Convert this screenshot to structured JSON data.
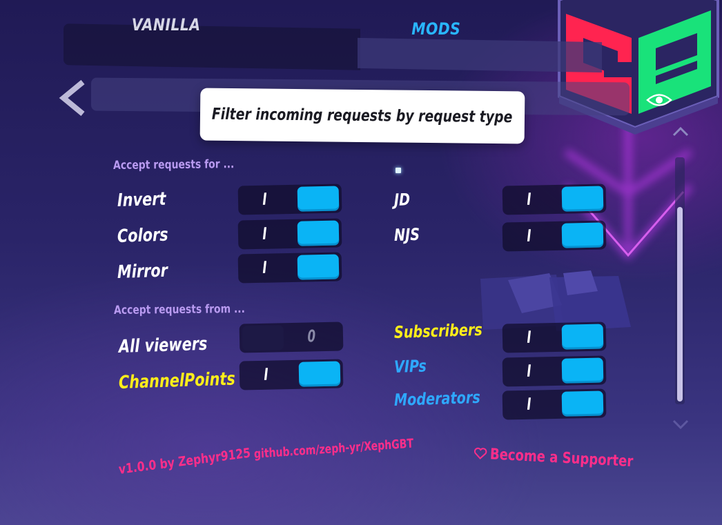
{
  "tabs": {
    "vanilla": "VANILLA",
    "mods": "MODS"
  },
  "tooltip": "Filter incoming requests by request type",
  "sections": {
    "types_header": "Accept requests for ...",
    "from_header": "Accept requests from ..."
  },
  "types": [
    {
      "label": "Invert",
      "state": "I",
      "on": true
    },
    {
      "label": "Colors",
      "state": "I",
      "on": true
    },
    {
      "label": "Mirror",
      "state": "I",
      "on": true
    },
    {
      "label": "JD",
      "state": "I",
      "on": true
    },
    {
      "label": "NJS",
      "state": "I",
      "on": true
    }
  ],
  "from": [
    {
      "label": "All viewers",
      "state": "0",
      "on": false
    },
    {
      "label": "ChannelPoints",
      "state": "I",
      "on": true
    },
    {
      "label": "Subscribers",
      "state": "I",
      "on": true
    },
    {
      "label": "VIPs",
      "state": "I",
      "on": true
    },
    {
      "label": "Moderators",
      "state": "I",
      "on": true
    }
  ],
  "footer": {
    "version": "v1.0.0 by Zephyr9125",
    "repo": "github.com/zeph-yr/XephGBT",
    "supporter": "Become a Supporter"
  },
  "colors": {
    "toggle_on": "#0ab4f5",
    "mods_tab": "#29b6ff",
    "section_header": "#b89af0",
    "yellow_label": "#ffee1a",
    "blue_label": "#2ea8ff",
    "footer_link": "#ff2e8a",
    "logo_red": "#ff2450",
    "logo_green": "#19e27a"
  },
  "icons": [
    "back-arrow-icon",
    "eye-icon",
    "chevron-up-icon",
    "chevron-down-icon",
    "heart-icon",
    "cube-logo-icon"
  ]
}
